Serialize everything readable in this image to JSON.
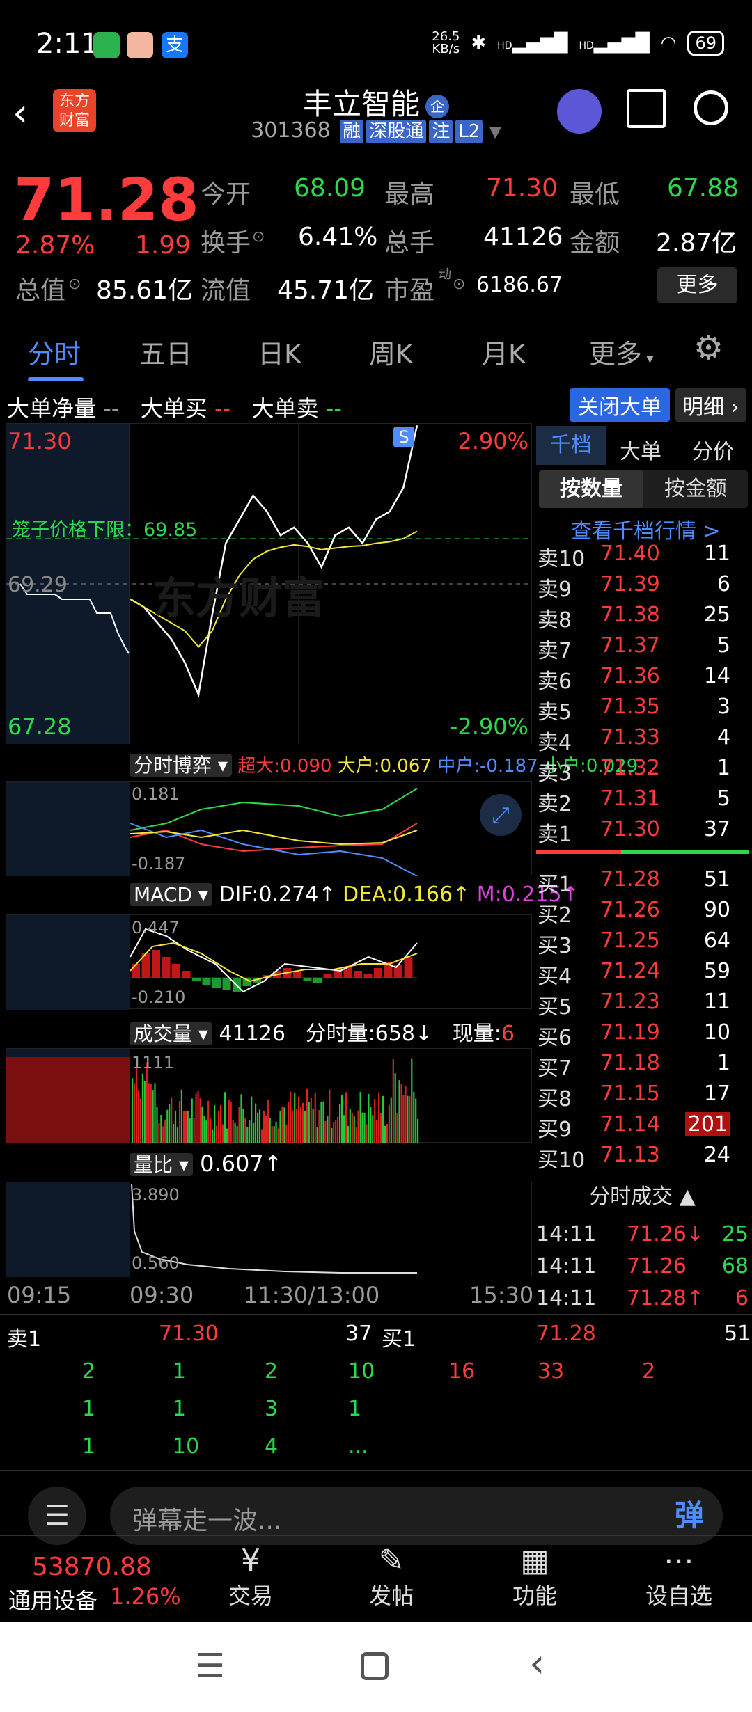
{
  "status_bar": {
    "time": "2:11",
    "net_speed": "26.5\nKB/s",
    "signal1": "HD",
    "signal2": "HD",
    "battery": "69"
  },
  "header": {
    "logo_text": "东方\n财富",
    "stock_name": "丰立智能",
    "badge": "企",
    "code": "301368",
    "tags": [
      "融",
      "深股通",
      "注",
      "L2"
    ]
  },
  "quote": {
    "price": "71.28",
    "change_pct": "2.87%",
    "change_amt": "1.99",
    "open_label": "今开",
    "open": "68.09",
    "high_label": "最高",
    "high": "71.30",
    "low_label": "最低",
    "low": "67.88",
    "turnover_label": "换手",
    "turnover": "6.41%",
    "volume_label": "总手",
    "volume": "41126",
    "amount_label": "金额",
    "amount": "2.87亿",
    "mcap_label": "总值",
    "mcap": "85.61亿",
    "float_label": "流值",
    "float": "45.71亿",
    "pe_label": "市盈",
    "pe_super": "动",
    "pe": "6186.67",
    "more_button": "更多"
  },
  "tabs": [
    "分时",
    "五日",
    "日K",
    "周K",
    "月K",
    "更多"
  ],
  "chart": {
    "big_order_net_label": "大单净量",
    "big_order_net": "--",
    "big_buy_label": "大单买",
    "big_buy": "--",
    "big_sell_label": "大单卖",
    "big_sell": "--",
    "close_big_button": "关闭大单",
    "detail_button": "明细",
    "price_high": "71.30",
    "price_low": "67.28",
    "pct_high": "2.90%",
    "pct_low": "-2.90%",
    "prev_close": "69.29",
    "cage_label": "笼子价格下限：69.85",
    "s_marker": "S",
    "watermark": "东方财富",
    "times": [
      "09:15",
      "09:30",
      "11:30/13:00",
      "15:30"
    ]
  },
  "chart_data": {
    "type": "line",
    "title": "",
    "x": [
      "09:30",
      "09:40",
      "09:50",
      "10:00",
      "10:10",
      "10:20",
      "10:30",
      "10:40",
      "10:50",
      "11:00",
      "11:10",
      "11:20",
      "11:30",
      "13:00",
      "13:10",
      "13:20",
      "13:30",
      "13:40",
      "13:50",
      "14:00",
      "14:10",
      "14:11"
    ],
    "series": [
      {
        "values": [
          69.1,
          69.0,
          68.8,
          68.6,
          68.3,
          67.9,
          68.9,
          69.8,
          70.1,
          70.4,
          70.2,
          69.9,
          70.0,
          69.8,
          69.5,
          69.9,
          70.0,
          69.8,
          70.1,
          70.2,
          70.5,
          71.28
        ]
      },
      {
        "values": [
          69.1,
          69.0,
          68.9,
          68.8,
          68.7,
          68.5,
          68.7,
          69.1,
          69.4,
          69.6,
          69.7,
          69.75,
          69.78,
          69.76,
          69.72,
          69.74,
          69.76,
          69.77,
          69.8,
          69.82,
          69.86,
          69.95
        ]
      }
    ],
    "ylim": [
      67.28,
      71.3
    ],
    "xlabel": "",
    "ylabel": ""
  },
  "indicator1": {
    "label": "分时博弈",
    "super_label": "超大:",
    "super": "0.090",
    "large_label": "大户:",
    "large": "0.067",
    "mid_label": "中户:",
    "mid": "-0.187",
    "small_label": "小户:",
    "small": "0.029",
    "top": "0.181",
    "bottom": "-0.187"
  },
  "macd": {
    "label": "MACD",
    "dif": "DIF:0.274↑",
    "dea": "DEA:0.166↑",
    "m": "M:0.215↑",
    "top": "0.447",
    "bottom": "-0.210"
  },
  "volume": {
    "label": "成交量",
    "total": "41126",
    "minute_vol": "分时量:658↓",
    "current_label": "现量:",
    "current": "6",
    "max": "1111"
  },
  "ratio": {
    "label": "量比",
    "value": "0.607↑",
    "top": "3.890",
    "bottom": "0.560"
  },
  "depth": {
    "tabs": [
      "千档",
      "大单",
      "分价"
    ],
    "subtabs": [
      "按数量",
      "按金额"
    ],
    "view_link": "查看千档行情 >",
    "asks": [
      {
        "label": "卖10",
        "price": "71.40",
        "qty": "11"
      },
      {
        "label": "卖9",
        "price": "71.39",
        "qty": "6"
      },
      {
        "label": "卖8",
        "price": "71.38",
        "qty": "25"
      },
      {
        "label": "卖7",
        "price": "71.37",
        "qty": "5"
      },
      {
        "label": "卖6",
        "price": "71.36",
        "qty": "14"
      },
      {
        "label": "卖5",
        "price": "71.35",
        "qty": "3"
      },
      {
        "label": "卖4",
        "price": "71.33",
        "qty": "4"
      },
      {
        "label": "卖3",
        "price": "71.32",
        "qty": "1"
      },
      {
        "label": "卖2",
        "price": "71.31",
        "qty": "5"
      },
      {
        "label": "卖1",
        "price": "71.30",
        "qty": "37"
      }
    ],
    "bids": [
      {
        "label": "买1",
        "price": "71.28",
        "qty": "51"
      },
      {
        "label": "买2",
        "price": "71.26",
        "qty": "90"
      },
      {
        "label": "买3",
        "price": "71.25",
        "qty": "64"
      },
      {
        "label": "买4",
        "price": "71.24",
        "qty": "59"
      },
      {
        "label": "买5",
        "price": "71.23",
        "qty": "11"
      },
      {
        "label": "买6",
        "price": "71.19",
        "qty": "10"
      },
      {
        "label": "买7",
        "price": "71.18",
        "qty": "1"
      },
      {
        "label": "买8",
        "price": "71.15",
        "qty": "17"
      },
      {
        "label": "买9",
        "price": "71.14",
        "qty": "201"
      },
      {
        "label": "买10",
        "price": "71.13",
        "qty": "24"
      }
    ],
    "ticks_label": "分时成交",
    "ticks": [
      {
        "time": "14:11",
        "price": "71.26↓",
        "qty": "25"
      },
      {
        "time": "14:11",
        "price": "71.26",
        "qty": "68"
      },
      {
        "time": "14:11",
        "price": "71.28↑",
        "qty": "6"
      }
    ]
  },
  "order_book": {
    "sell_label": "卖1",
    "sell_price": "71.30",
    "sell_qty": "37",
    "buy_label": "买1",
    "buy_price": "71.28",
    "buy_qty": "51",
    "sell_rows": [
      [
        "2",
        "1",
        "2",
        "10"
      ],
      [
        "1",
        "1",
        "3",
        "1"
      ],
      [
        "1",
        "10",
        "4",
        "..."
      ]
    ],
    "buy_rows": [
      [
        "16",
        "33",
        "2"
      ]
    ]
  },
  "comment": {
    "placeholder": "弹幕走一波...",
    "danmu_button": "弹"
  },
  "bottom_bar": {
    "index_value": "53870.88",
    "index_name": "通用设备",
    "index_change": "1.26%",
    "items": [
      "交易",
      "发帖",
      "功能",
      "设自选"
    ]
  }
}
